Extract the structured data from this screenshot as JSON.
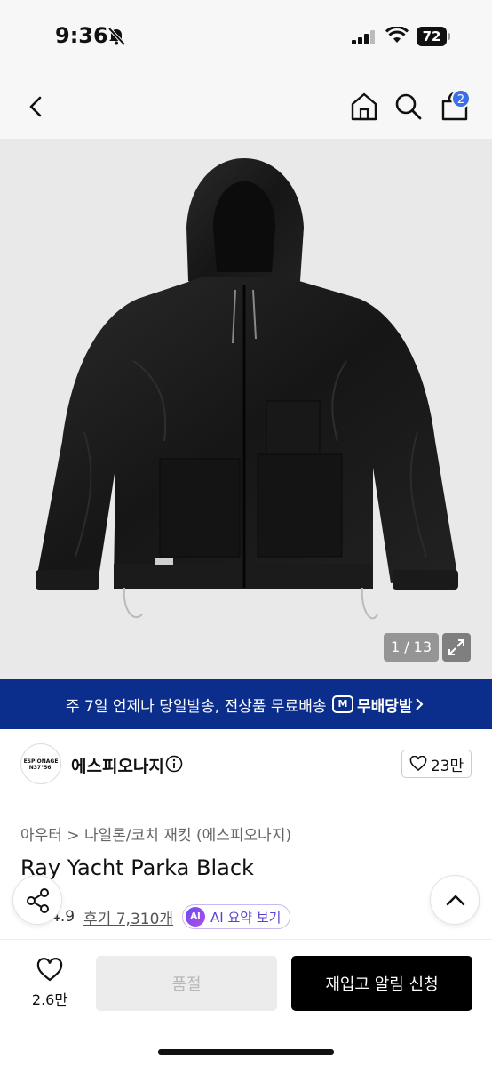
{
  "status_bar": {
    "time": "9:36",
    "battery": "72"
  },
  "header": {
    "cart_count": "2"
  },
  "gallery": {
    "counter": "1 / 13"
  },
  "shipping_banner": {
    "text": "주 7일 언제나 당일발송, 전상품 무료배송",
    "logo_mark": "M",
    "logo_text": "무배당발"
  },
  "brand": {
    "logo_text": "ESPIONAGE N37°56'",
    "name": "에스피오나지",
    "like_count": "23만"
  },
  "product": {
    "breadcrumb": "아우터 > 나일론/코치 재킷 (에스피오나지)",
    "name": "Ray Yacht Parka Black",
    "rating": "4.9",
    "review_link": "후기 7,310개",
    "ai_badge": "AI",
    "ai_label": "AI 요약 보기"
  },
  "bottom_bar": {
    "wish_count": "2.6만",
    "soldout_label": "품절",
    "restock_label": "재입고 알림 신청"
  },
  "colors": {
    "banner": "#0b2d8c",
    "badge": "#3b6ee8",
    "primary_button": "#000000"
  }
}
